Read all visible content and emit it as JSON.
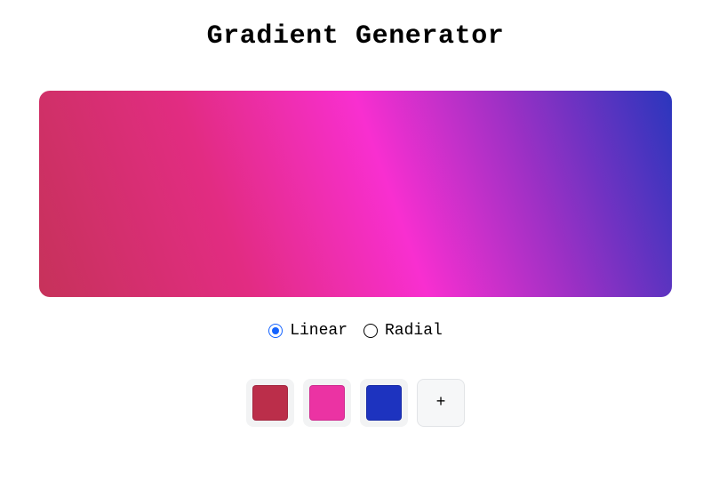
{
  "title": "Gradient Generator",
  "preview": {
    "type": "linear",
    "angle_deg": 70,
    "stops": [
      {
        "color": "#c6325a",
        "pos": 0
      },
      {
        "color": "#e22c82",
        "pos": 30
      },
      {
        "color": "#f82fd0",
        "pos": 55
      },
      {
        "color": "#a030c5",
        "pos": 75
      },
      {
        "color": "#2a36bd",
        "pos": 100
      }
    ]
  },
  "type_options": {
    "linear": {
      "label": "Linear",
      "selected": true
    },
    "radial": {
      "label": "Radial",
      "selected": false
    }
  },
  "swatches": [
    {
      "color": "#BB2E4A"
    },
    {
      "color": "#EB33A3"
    },
    {
      "color": "#1D33BF"
    }
  ],
  "add_button_label": "+"
}
